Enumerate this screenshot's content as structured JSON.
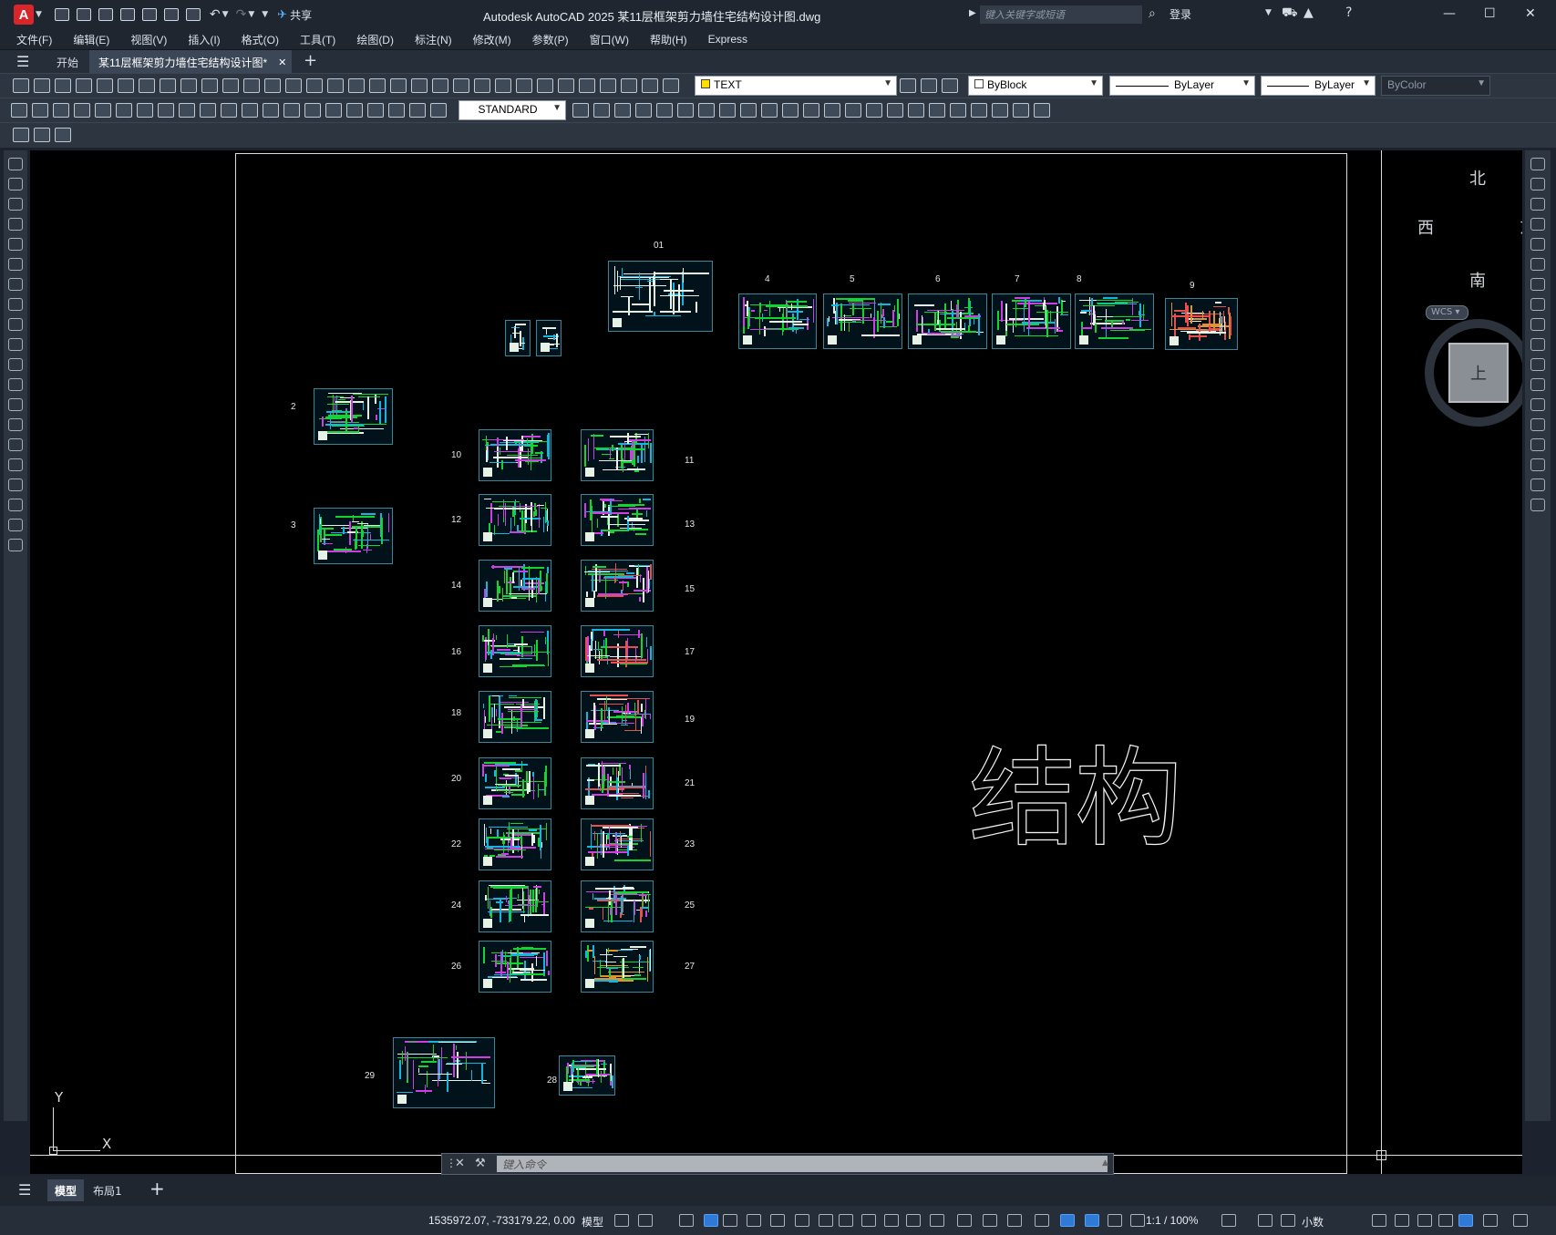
{
  "titlebar": {
    "app_badge": "A",
    "share_label": "共享",
    "window_title": "Autodesk AutoCAD 2025    某11层框架剪力墙住宅结构设计图.dwg",
    "search_placeholder": "键入关键字或短语",
    "login_label": "登录"
  },
  "menu": [
    "文件(F)",
    "编辑(E)",
    "视图(V)",
    "插入(I)",
    "格式(O)",
    "工具(T)",
    "绘图(D)",
    "标注(N)",
    "修改(M)",
    "参数(P)",
    "窗口(W)",
    "帮助(H)",
    "Express"
  ],
  "tabs": {
    "start": "开始",
    "active_doc": "某11层框架剪力墙住宅结构设计图*"
  },
  "toolbar": {
    "layer_name": "TEXT",
    "color": "ByBlock",
    "linetype": "ByLayer",
    "lineweight": "ByLayer",
    "plotstyle": "ByColor",
    "dimstyle": "STANDARD"
  },
  "viewcube": {
    "north": "北",
    "south": "南",
    "east": "东",
    "west": "西",
    "top": "上",
    "wcs": "WCS"
  },
  "drawing": {
    "big_text": "结构",
    "labels": [
      "01",
      "4",
      "5",
      "6",
      "7",
      "8",
      "9",
      "2",
      "3",
      "10",
      "11",
      "12",
      "13",
      "14",
      "15",
      "16",
      "17",
      "18",
      "19",
      "20",
      "21",
      "22",
      "23",
      "24",
      "25",
      "26",
      "27",
      "28",
      "29"
    ],
    "ucs_x": "X",
    "ucs_y": "Y"
  },
  "command": {
    "placeholder": "键入命令"
  },
  "layouts": {
    "model": "模型",
    "layout1": "布局1"
  },
  "status": {
    "coords": "1535972.07, -733179.22, 0.00",
    "space": "模型",
    "scale": "1:1 / 100%",
    "units": "小数"
  }
}
